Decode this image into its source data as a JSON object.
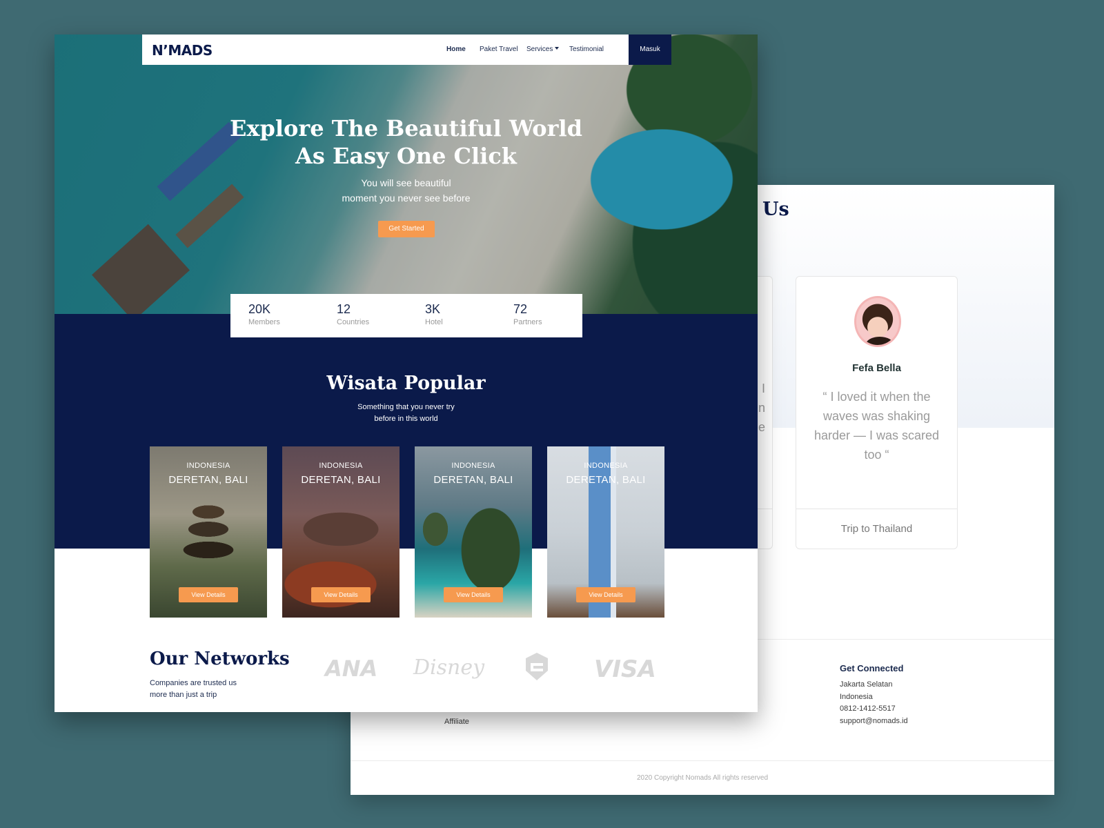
{
  "brand": {
    "logo": "N’MADS"
  },
  "nav": {
    "home": "Home",
    "paket": "Paket Travel",
    "services": "Services",
    "testimonial": "Testimonial",
    "masuk": "Masuk"
  },
  "hero": {
    "title_line1": "Explore The Beautiful World",
    "title_line2": "As Easy One Click",
    "sub_line1": "You will see beautiful",
    "sub_line2": "moment you never see before",
    "cta": "Get Started"
  },
  "stats": [
    {
      "value": "20K",
      "label": "Members"
    },
    {
      "value": "12",
      "label": "Countries"
    },
    {
      "value": "3K",
      "label": "Hotel"
    },
    {
      "value": "72",
      "label": "Partners"
    }
  ],
  "popular": {
    "title": "Wisata Popular",
    "sub_line1": "Something that you never try",
    "sub_line2": "before in this world",
    "cards": [
      {
        "country": "INDONESIA",
        "place": "DERETAN, BALI",
        "button": "View Details"
      },
      {
        "country": "INDONESIA",
        "place": "DERETAN, BALI",
        "button": "View Details"
      },
      {
        "country": "INDONESIA",
        "place": "DERETAN, BALI",
        "button": "View Details"
      },
      {
        "country": "INDONESIA",
        "place": "DERETAN, BALI",
        "button": "View Details"
      }
    ]
  },
  "networks": {
    "title": "Our Networks",
    "sub_line1": "Companies are trusted us",
    "sub_line2": "more than just a trip",
    "partners": [
      "ANA",
      "Disney",
      "VISA"
    ]
  },
  "testimonials": {
    "heading_partial": "Us",
    "partial_chars": [
      "d I",
      "n",
      "e"
    ],
    "card": {
      "name": "Fefa Bella",
      "quote": "“ I loved it when the waves was shaking harder — I was scared too “",
      "trip": "Trip to Thailand"
    }
  },
  "footer": {
    "affiliate": "Affiliate",
    "connected": {
      "title": "Get Connected",
      "lines": [
        "Jakarta Selatan",
        "Indonesia",
        "0812-1412-5517",
        "support@nomads.id"
      ]
    },
    "copyright": "2020 Copyright Nomads All rights reserved"
  },
  "colors": {
    "navy": "#0b1a4a",
    "orange": "#f69a4f",
    "backdrop": "#3f6a72"
  }
}
